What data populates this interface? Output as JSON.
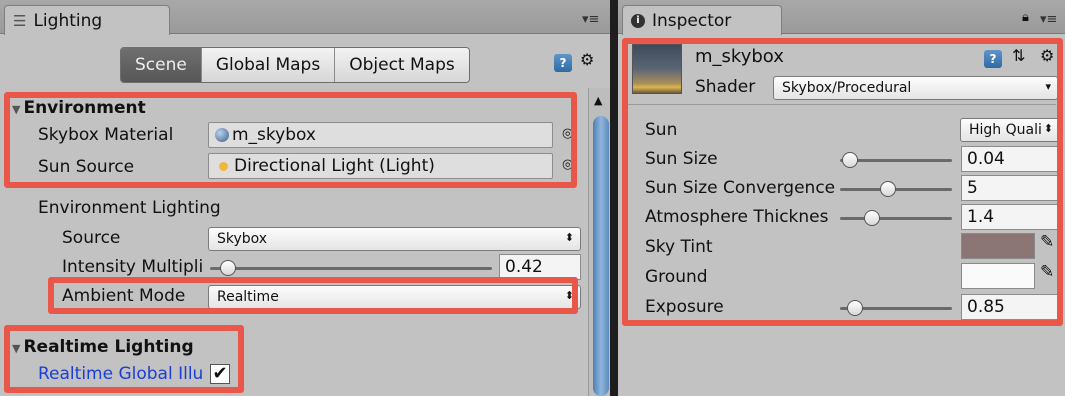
{
  "lighting": {
    "tab_title": "Lighting",
    "tabs": [
      {
        "label": "Scene",
        "active": true
      },
      {
        "label": "Global Maps",
        "active": false
      },
      {
        "label": "Object Maps",
        "active": false
      }
    ],
    "environment": {
      "header": "Environment",
      "skybox_label": "Skybox Material",
      "skybox_value": "m_skybox",
      "sun_label": "Sun Source",
      "sun_value": "Directional Light (Light)",
      "env_lighting_label": "Environment Lighting",
      "source_label": "Source",
      "source_value": "Skybox",
      "intensity_label": "Intensity Multipli",
      "intensity_value": "0.42",
      "ambient_label": "Ambient Mode",
      "ambient_value": "Realtime"
    },
    "realtime": {
      "header": "Realtime Lighting",
      "gi_label": "Realtime Global Illu",
      "gi_checked": true
    }
  },
  "inspector": {
    "tab_title": "Inspector",
    "material_name": "m_skybox",
    "shader_label": "Shader",
    "shader_value": "Skybox/Procedural",
    "properties": {
      "sun_label": "Sun",
      "sun_value": "High Quali",
      "sun_size_label": "Sun Size",
      "sun_size_value": "0.04",
      "sun_conv_label": "Sun Size Convergence",
      "sun_conv_value": "5",
      "atmos_label": "Atmosphere Thicknes",
      "atmos_value": "1.4",
      "sky_tint_label": "Sky Tint",
      "ground_label": "Ground",
      "exposure_label": "Exposure",
      "exposure_value": "0.85"
    },
    "colors": {
      "sky_tint": "#8c7575",
      "ground": "#fafafa"
    }
  },
  "colors": {
    "highlight_box": "#e8574a",
    "link_text": "#1a3fd6"
  }
}
